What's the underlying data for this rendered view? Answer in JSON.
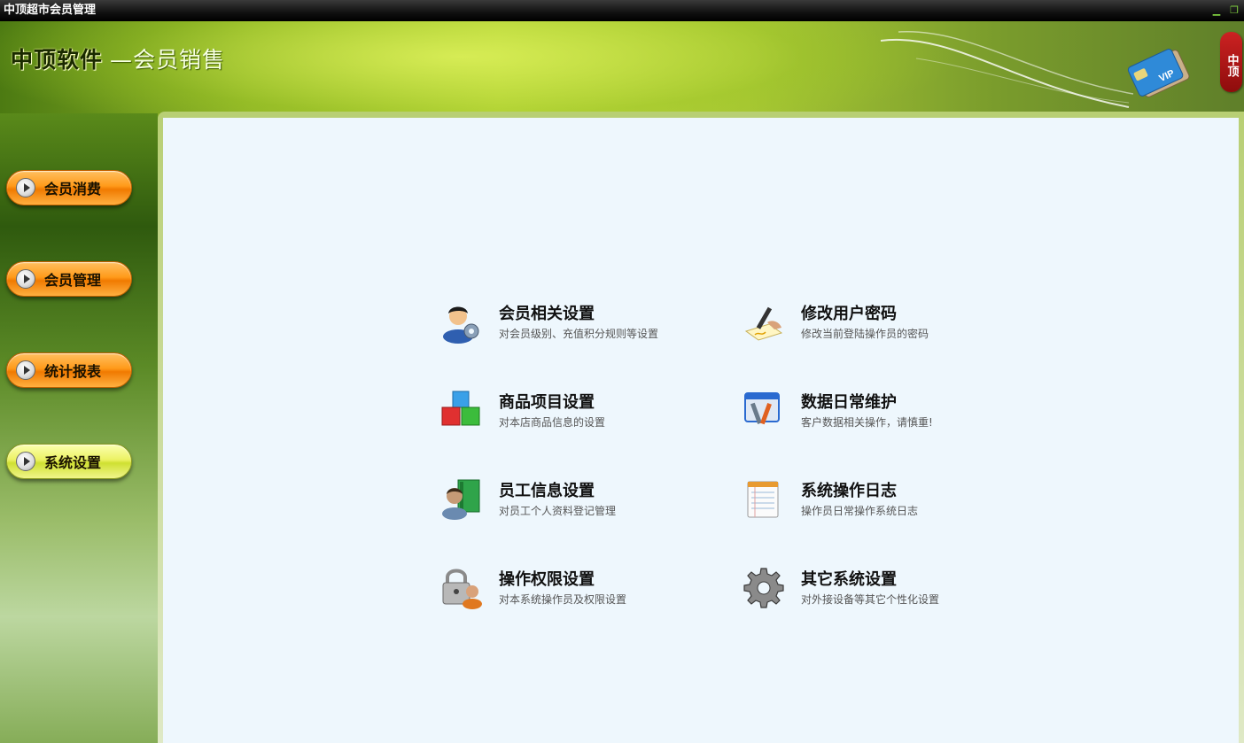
{
  "window": {
    "title": "中顶超市会员管理",
    "controls": [
      "minimize",
      "restore"
    ]
  },
  "header": {
    "brand": "中顶软件",
    "subtitle": "—会员销售",
    "seal_text": "中顶",
    "card_text": "VIP"
  },
  "sidebar": {
    "items": [
      {
        "label": "会员消费",
        "active": false
      },
      {
        "label": "会员管理",
        "active": false
      },
      {
        "label": "统计报表",
        "active": false
      },
      {
        "label": "系统设置",
        "active": true
      }
    ]
  },
  "main": {
    "items": [
      {
        "title": "会员相关设置",
        "desc": "对会员级别、充值积分规则等设置",
        "icon": "member-settings-icon"
      },
      {
        "title": "修改用户密码",
        "desc": "修改当前登陆操作员的密码",
        "icon": "pen-signature-icon"
      },
      {
        "title": "商品项目设置",
        "desc": "对本店商品信息的设置",
        "icon": "product-cubes-icon"
      },
      {
        "title": "数据日常维护",
        "desc": "客户数据相关操作，请慎重!",
        "icon": "maintenance-tools-icon"
      },
      {
        "title": "员工信息设置",
        "desc": "对员工个人资料登记管理",
        "icon": "employee-book-icon"
      },
      {
        "title": "系统操作日志",
        "desc": "操作员日常操作系统日志",
        "icon": "notepad-log-icon"
      },
      {
        "title": "操作权限设置",
        "desc": "对本系统操作员及权限设置",
        "icon": "padlock-user-icon"
      },
      {
        "title": "其它系统设置",
        "desc": "对外接设备等其它个性化设置",
        "icon": "gear-icon"
      }
    ]
  },
  "colors": {
    "nav_orange": "#ff9a1a",
    "nav_active": "#e6ee5a",
    "panel_bg": "#eef7fd"
  }
}
